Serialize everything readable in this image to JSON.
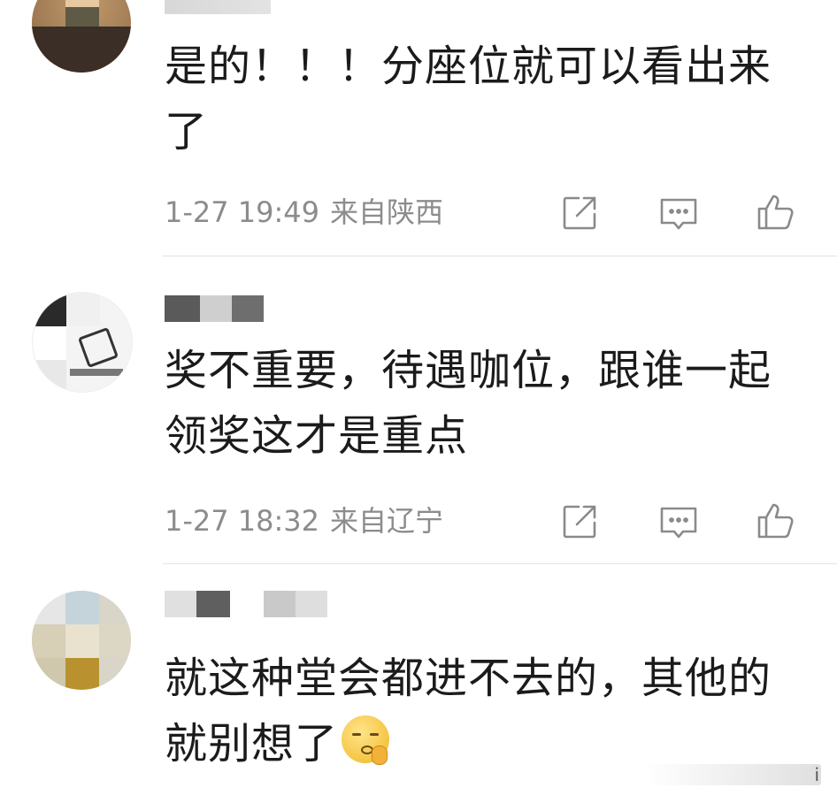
{
  "comments": [
    {
      "username": "",
      "text": "是的！！！分座位就可以看出来了",
      "time": "1-27 19:49",
      "location": "来自陕西"
    },
    {
      "username": "",
      "text": "奖不重要，待遇咖位，跟谁一起领奖这才是重点",
      "time": "1-27 18:32",
      "location": "来自辽宁"
    },
    {
      "username": "",
      "text": "就这种堂会都进不去的，其他的就别想了",
      "emoji": "shush-emoji"
    }
  ],
  "icons": {
    "share": "share-icon",
    "reply": "comment-icon",
    "like": "thumbs-up-icon"
  },
  "colors": {
    "text": "#1b1b1b",
    "meta": "#8c8c8c",
    "icon": "#8a8a8a",
    "divider": "#e2e2e2"
  }
}
